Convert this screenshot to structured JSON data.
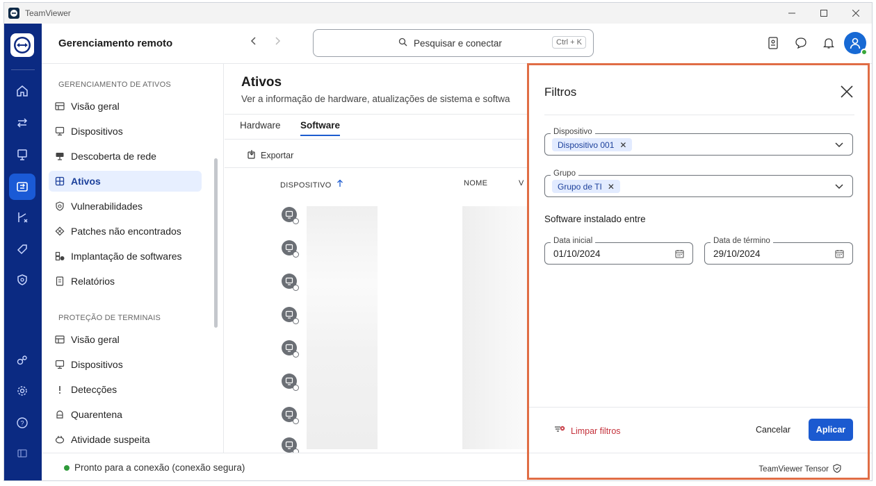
{
  "window": {
    "title": "TeamViewer",
    "controls": [
      "minimize",
      "maximize",
      "close"
    ]
  },
  "header": {
    "app_title": "Gerenciamento remoto",
    "search_placeholder": "Pesquisar e conectar",
    "search_shortcut": "Ctrl + K"
  },
  "sidebar": {
    "section1": "GERENCIAMENTO DE ATIVOS",
    "items1": [
      {
        "label": "Visão geral",
        "icon": "dashboard-icon"
      },
      {
        "label": "Dispositivos",
        "icon": "monitor-icon"
      },
      {
        "label": "Descoberta de rede",
        "icon": "network-icon"
      },
      {
        "label": "Ativos",
        "icon": "grid-icon",
        "active": true
      },
      {
        "label": "Vulnerabilidades",
        "icon": "shield-search-icon"
      },
      {
        "label": "Patches não encontrados",
        "icon": "patch-icon"
      },
      {
        "label": "Implantação de softwares",
        "icon": "deploy-icon"
      },
      {
        "label": "Relatórios",
        "icon": "report-icon"
      }
    ],
    "section2": "PROTEÇÃO DE TERMINAIS",
    "items2": [
      {
        "label": "Visão geral",
        "icon": "dashboard-icon"
      },
      {
        "label": "Dispositivos",
        "icon": "monitor-icon"
      },
      {
        "label": "Detecções",
        "icon": "exclamation-icon"
      },
      {
        "label": "Quarentena",
        "icon": "quarantine-icon"
      },
      {
        "label": "Atividade suspeita",
        "icon": "activity-icon"
      }
    ]
  },
  "status": {
    "text": "Pronto para a conexão (conexão segura)",
    "color": "#2f9a3a"
  },
  "content": {
    "title": "Ativos",
    "subtitle": "Ver a informação de hardware, atualizações de sistema e softwa",
    "tabs": [
      "Hardware",
      "Software"
    ],
    "active_tab": "Software",
    "export_label": "Exportar",
    "columns": [
      "DISPOSITIVO",
      "NOME",
      "V"
    ],
    "sort": "ascending"
  },
  "filters": {
    "title": "Filtros",
    "device_label": "Dispositivo",
    "device_chip": "Dispositivo 001",
    "group_label": "Grupo",
    "group_chip": "Grupo de TI",
    "section_title": "Software instalado entre",
    "start_label": "Data inicial",
    "start_value": "01/10/2024",
    "end_label": "Data de término",
    "end_value": "29/10/2024",
    "clear_label": "Limpar filtros",
    "cancel_label": "Cancelar",
    "apply_label": "Aplicar",
    "footer_brand": "TeamViewer Tensor"
  },
  "colors": {
    "accent": "#1b5ad0",
    "rail": "#0b2a82",
    "highlight_border": "#e06d45",
    "danger": "#c4303a"
  }
}
